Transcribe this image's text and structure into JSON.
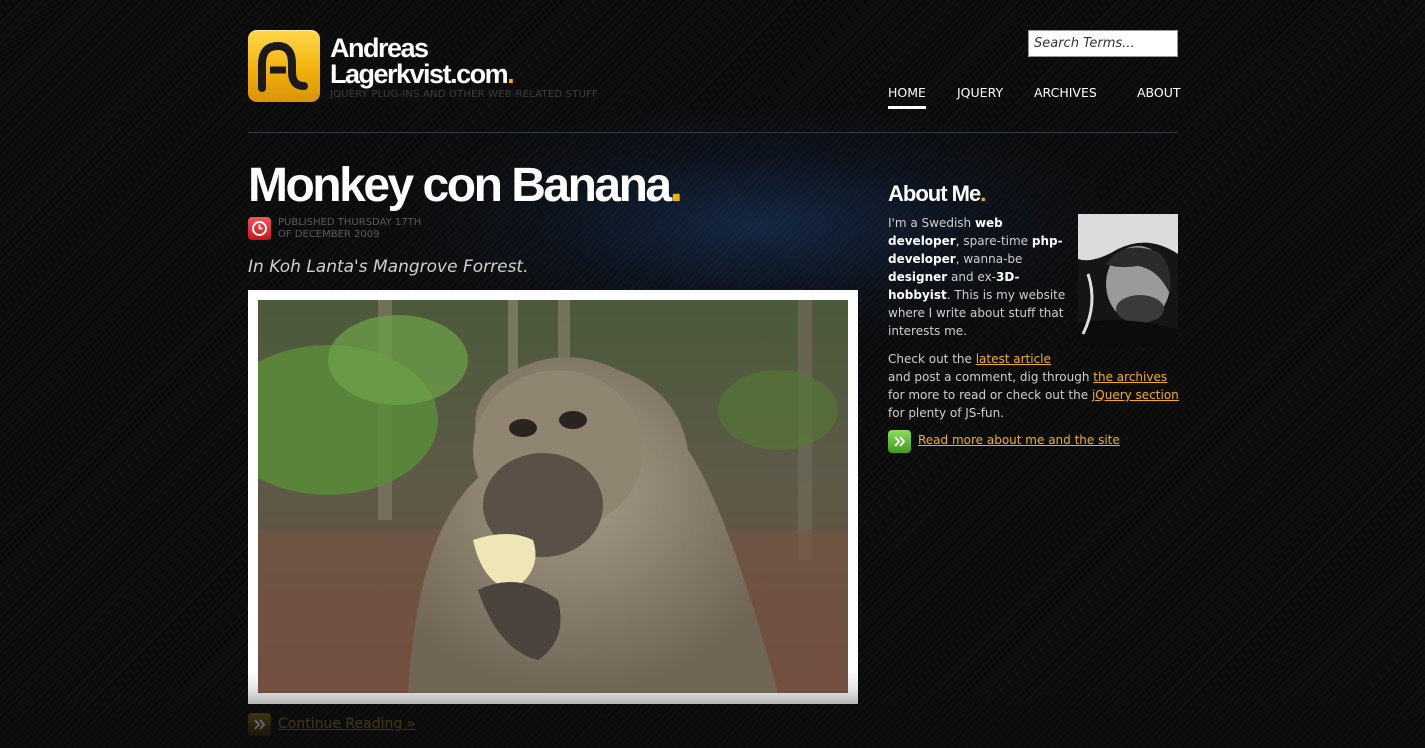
{
  "site": {
    "name_line1": "Andreas",
    "name_line2": "Lagerkvist.com",
    "name_dot": ".",
    "tagline": "jQuery plug-ins and other web-related stuff",
    "logo_icon": "al-monogram-logo",
    "accent_color": "#f2b10c"
  },
  "search": {
    "placeholder": "Search Terms..."
  },
  "nav": {
    "items": [
      {
        "label": "HOME",
        "active": true
      },
      {
        "label": "JQUERY",
        "active": false
      },
      {
        "label": "ARCHIVES",
        "active": false
      },
      {
        "label": "ABOUT",
        "active": false
      }
    ]
  },
  "post": {
    "title": "Monkey con Banana",
    "title_dot": ".",
    "date_line1": "Published Thursday 17th",
    "date_line2": "of December 2009",
    "date_icon": "clock-icon",
    "subtitle": "In Koh Lanta's Mangrove Forrest.",
    "image_subject": "monkey eating banana",
    "continue_label": "Continue Reading »"
  },
  "sidebar": {
    "title": "About Me",
    "title_dot": ".",
    "intro": {
      "t1": "I'm a Swedish ",
      "b1": "web developer",
      "t2": ", spare-time ",
      "b2": "php-developer",
      "t3": ", wanna-be ",
      "b3": "designer",
      "t4": " and ex-",
      "b4": "3D-hobbyist",
      "t5": ". This is my website where I write about stuff that interests me."
    },
    "more": {
      "t1": "Check out the ",
      "link1": "latest article",
      "t2": " and post a comment, dig through ",
      "link2": "the archives",
      "t3": " for more to read or check out the ",
      "link3": "jQuery section",
      "t4": " for plenty of JS-fun."
    },
    "read_more_label": "Read more about me and the site",
    "read_more_icon": "double-chevron-right-icon"
  }
}
